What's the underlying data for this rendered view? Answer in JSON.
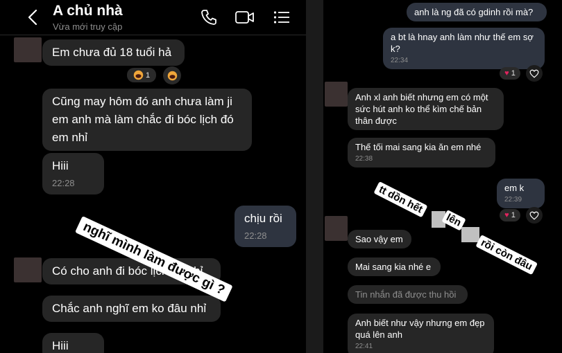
{
  "left": {
    "header": {
      "title": "A chủ nhà",
      "subtitle": "Vừa mới truy cập"
    },
    "messages": [
      {
        "text": "Em chưa đủ 18 tuổi hả"
      },
      {
        "text": "Cũng may hôm đó anh chưa làm ji em anh mà làm chắc đi bóc lịch đó em nhỉ"
      },
      {
        "text": "Hiii",
        "time": "22:28"
      },
      {
        "text": "chịu rồi",
        "time": "22:28"
      },
      {
        "text": "Có cho anh đi bóc lịch ko nhỉ"
      },
      {
        "text": "Chắc anh nghĩ em ko đâu nhỉ"
      },
      {
        "text": "Hiii"
      }
    ],
    "reaction_count": "1",
    "sticker": "nghĩ mình làm được gì ?"
  },
  "right": {
    "messages": [
      {
        "text": "anh là ng đã có gdinh rồi mà?"
      },
      {
        "text": "a bt là hnay anh làm như thế em sợ k?",
        "time": "22:34"
      },
      {
        "text": "Anh xl anh biết nhưng em có một sức hút anh ko thể kìm chế bản thân được"
      },
      {
        "text": "Thế tối mai sang kia ăn em nhé",
        "time": "22:38"
      },
      {
        "text": "em k",
        "time": "22:39"
      },
      {
        "text": "Sao vậy em"
      },
      {
        "text": "Mai sang kia nhé e"
      },
      {
        "text": "Tin nhắn đã được thu hồi"
      },
      {
        "text": "Anh biết như vậy nhưng em đẹp quá lên anh",
        "time": "22:41"
      }
    ],
    "reaction_count": "1",
    "sticker_lines": [
      "tt dồn hết",
      "lên",
      "rồi còn đâu"
    ]
  },
  "colors": {
    "incoming": "#262626",
    "outgoing": "#2e3440",
    "heart": "#e0245e"
  }
}
